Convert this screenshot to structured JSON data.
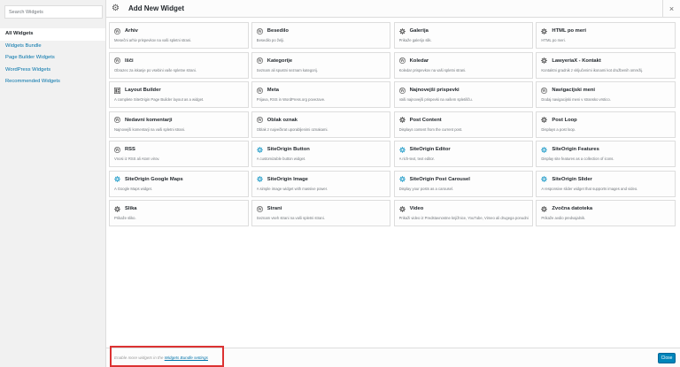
{
  "sidebar": {
    "search_placeholder": "Search Widgets",
    "items": [
      {
        "label": "All Widgets"
      },
      {
        "label": "Widgets Bundle"
      },
      {
        "label": "Page Builder Widgets"
      },
      {
        "label": "WordPress Widgets"
      },
      {
        "label": "Recommended Widgets"
      }
    ]
  },
  "header": {
    "title": "Add New Widget",
    "close_glyph": "×"
  },
  "widgets": [
    {
      "title": "Arhiv",
      "desc": "Mesečni arhiv prispevkov na vaši spletni strani.",
      "icon": "wordpress-icon"
    },
    {
      "title": "Besedilo",
      "desc": "Besedilo po želji.",
      "icon": "wordpress-icon"
    },
    {
      "title": "Galerija",
      "desc": "Prikaže galerijo slik.",
      "icon": "gear-icon"
    },
    {
      "title": "HTML po meri",
      "desc": "HTML po meri.",
      "icon": "gear-icon"
    },
    {
      "title": "Išči",
      "desc": "Obrazec za iskanje po vsebini vaše spletne strani.",
      "icon": "wordpress-icon"
    },
    {
      "title": "Kategorije",
      "desc": "Seznam ali spustni seznam kategorij.",
      "icon": "wordpress-icon"
    },
    {
      "title": "Koledar",
      "desc": "Koledar prispevkov na vaši spletni strani.",
      "icon": "wordpress-icon"
    },
    {
      "title": "LawyeriaX - Kontakt",
      "desc": "Kontaktni gradnik z vključenimi ikonami kot družbenih omrežij.",
      "icon": "gear-icon"
    },
    {
      "title": "Layout Builder",
      "desc": "A complete SiteOrigin Page Builder layout as a widget.",
      "icon": "layout-icon"
    },
    {
      "title": "Meta",
      "desc": "Prijava, RSS in WordPress.org povezave.",
      "icon": "wordpress-icon"
    },
    {
      "title": "Najnovejši prispevki",
      "desc": "Vaši najnovejši prispevki na vašem spletišču.",
      "icon": "wordpress-icon"
    },
    {
      "title": "Navigacijski meni",
      "desc": "Dodaj navigacijski meni v stransko vrstico.",
      "icon": "wordpress-icon"
    },
    {
      "title": "Nedavni komentarji",
      "desc": "Najnovejši komentarji na vaši spletni strani.",
      "icon": "wordpress-icon"
    },
    {
      "title": "Oblak oznak",
      "desc": "Oblak z največkrat uporabljenimi oznakami.",
      "icon": "wordpress-icon"
    },
    {
      "title": "Post Content",
      "desc": "Displays content from the current post.",
      "icon": "gear-icon"
    },
    {
      "title": "Post Loop",
      "desc": "Displays a post loop.",
      "icon": "gear-icon"
    },
    {
      "title": "RSS",
      "desc": "Vnosi iz RSS ali Atom virov.",
      "icon": "wordpress-icon"
    },
    {
      "title": "SiteOrigin Button",
      "desc": "A customizable button widget.",
      "icon": "siteorigin-icon"
    },
    {
      "title": "SiteOrigin Editor",
      "desc": "A rich-text, text editor.",
      "icon": "siteorigin-icon"
    },
    {
      "title": "SiteOrigin Features",
      "desc": "Display site features as a collection of icons.",
      "icon": "siteorigin-icon"
    },
    {
      "title": "SiteOrigin Google Maps",
      "desc": "A Google Maps widget.",
      "icon": "siteorigin-icon"
    },
    {
      "title": "SiteOrigin Image",
      "desc": "A simple image widget with massive power.",
      "icon": "siteorigin-icon"
    },
    {
      "title": "SiteOrigin Post Carousel",
      "desc": "Display your posts as a carousel.",
      "icon": "siteorigin-icon"
    },
    {
      "title": "SiteOrigin Slider",
      "desc": "A responsive slider widget that supports images and video.",
      "icon": "siteorigin-icon"
    },
    {
      "title": "Slika",
      "desc": "Prikaže sliko.",
      "icon": "gear-icon"
    },
    {
      "title": "Strani",
      "desc": "Seznam vseh strani na vaši spletni strani.",
      "icon": "wordpress-icon"
    },
    {
      "title": "Video",
      "desc": "Prikaži video iz Predstavnostne knjižnice, YouTube, Vimeo ali drugega ponudnika.",
      "icon": "gear-icon"
    },
    {
      "title": "Zvočna datoteka",
      "desc": "Prikaže avdio predvajalnik.",
      "icon": "gear-icon"
    }
  ],
  "footer": {
    "note_prefix": "Enable more widgets in the ",
    "note_link": "Widgets Bundle settings",
    "close_label": "Close"
  },
  "colors": {
    "accent": "#0073aa",
    "siteorigin_icon": "#2ea2cc",
    "highlight_border": "#dc3232"
  }
}
